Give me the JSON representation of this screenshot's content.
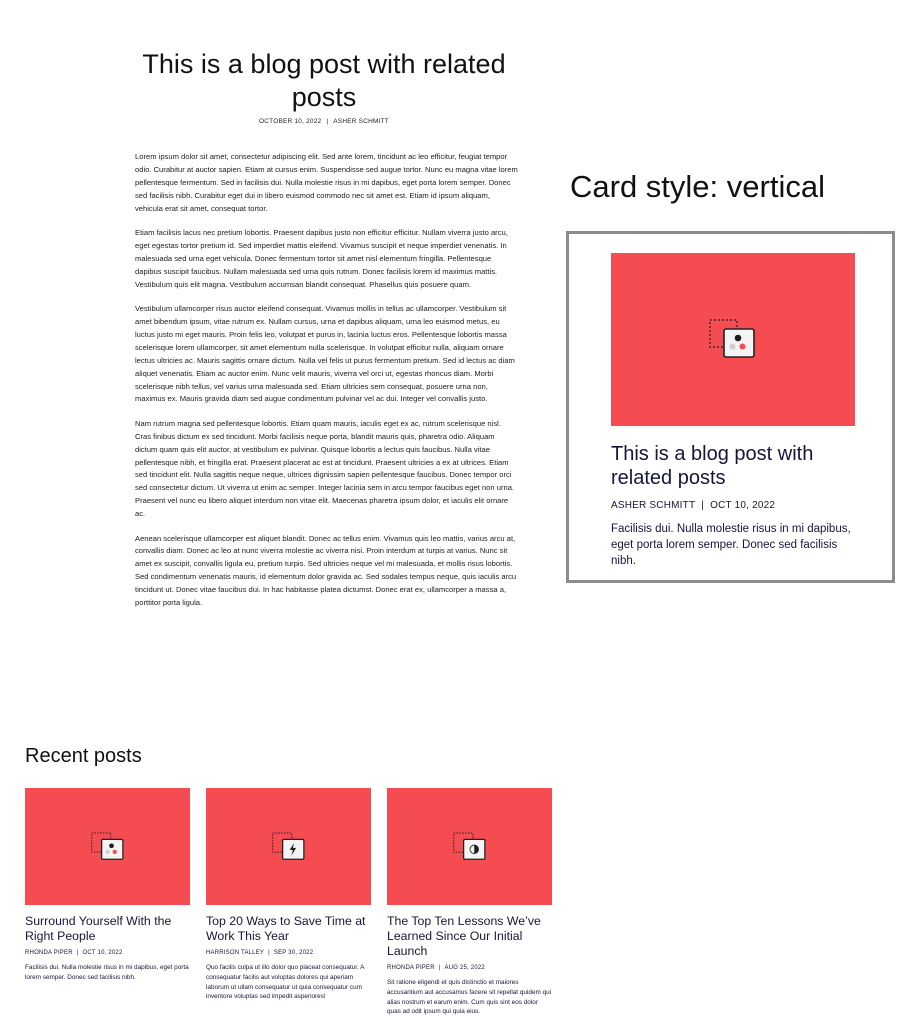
{
  "post": {
    "title": "This is a blog post with related posts",
    "date": "OCTOBER 10, 2022",
    "author": "ASHER SCHMITT",
    "paragraphs": [
      "Lorem ipsum dolor sit amet, consectetur adipiscing elit. Sed ante lorem, tincidunt ac leo efficitur, feugiat tempor odio. Curabitur at auctor sapien. Etiam at cursus enim. Suspendisse sed augue tortor. Nunc eu magna vitae lorem pellentesque fermentum. Sed in facilisis dui. Nulla molestie risus in mi dapibus, eget porta lorem semper. Donec sed facilisis nibh. Curabitur eget dui in libero euismod commodo nec sit amet est. Etiam id ipsum aliquam, vehicula erat sit amet, consequat tortor.",
      "Etiam facilisis lacus nec pretium lobortis. Praesent dapibus justo non efficitur efficitur. Nullam viverra justo arcu, eget egestas tortor pretium id. Sed imperdiet mattis eleifend. Vivamus suscipit et neque imperdiet venenatis. In malesuada sed urna eget vehicula. Donec fermentum tortor sit amet nisl elementum fringilla. Pellentesque dapibus suscipit faucibus. Nullam malesuada sed urna quis rutrum. Donec facilisis lorem id maximus mattis. Vestibulum quis elit magna. Vestibulum accumsan blandit consequat. Phasellus quis posuere quam.",
      "Vestibulum ullamcorper risus auctor eleifend consequat. Vivamus mollis in tellus ac ullamcorper. Vestibulum sit amet bibendum ipsum, vitae rutrum ex. Nullam cursus, urna et dapibus aliquam, urna leo euismod metus, eu luctus justo mi eget mauris. Proin felis leo, volutpat et purus in, lacinia luctus eros. Pellentesque lobortis massa scelerisque lorem ullamcorper, sit amet elementum nulla scelerisque. In volutpat efficitur nulla, aliquam ornare lectus ultricies ac. Mauris sagittis ornare dictum. Nulla vel felis ut purus fermentum pretium. Sed id lectus ac diam aliquet venenatis. Etiam ac auctor enim. Nunc velit mauris, viverra vel orci ut, egestas rhoncus diam. Morbi scelerisque nibh tellus, vel varius urna malesuada sed. Etiam ultricies sem consequat, posuere urna non, maximus ex. Mauris gravida diam sed augue condimentum pulvinar vel ac dui. Integer vel convallis justo.",
      "Nam rutrum magna sed pellentesque lobortis. Etiam quam mauris, iaculis eget ex ac, rutrum scelerisque nisl. Cras finibus dictum ex sed tincidunt. Morbi facilisis neque porta, blandit mauris quis, pharetra odio. Aliquam dictum quam quis elit auctor, at vestibulum ex pulvinar. Quisque lobortis a lectus quis faucibus. Nulla vitae pellentesque nibh, et fringilla erat. Praesent placerat ac est at tincidunt. Praesent ultricies a ex at ultrices. Etiam sed tincidunt elit. Nulla sagittis neque neque, ultrices dignissim sapien pellentesque faucibus. Donec tempor orci sed consectetur dictum. Ut viverra ut enim ac semper. Integer lacinia sem in arcu tempor faucibus eget non urna. Praesent vel nunc eu libero aliquet interdum non vitae elit. Maecenas pharetra ipsum dolor, et iaculis elit ornare ac.",
      "Aenean scelerisque ullamcorper est aliquet blandit. Donec ac tellus enim. Vivamus quis leo mattis, varius arcu at, convallis diam. Donec ac leo at nunc viverra molestie ac viverra nisi. Proin interdum at turpis at varius. Nunc sit amet ex suscipit, convallis ligula eu, pretium turpis. Sed ultricies neque vel mi malesuada, et mollis risus lobortis. Sed condimentum venenatis mauris, id elementum dolor gravida ac. Sed sodales tempus neque, quis iaculis arcu tincidunt ut. Donec vitae faucibus dui. In hac habitasse platea dictumst. Donec erat ex, ullamcorper a massa a, porttitor porta ligula."
    ]
  },
  "card_style_label": "Card style: vertical",
  "card": {
    "title": "This is a blog post with related posts",
    "author": "ASHER SCHMITT",
    "date": "OCT 10, 2022",
    "excerpt": "Facilisis dui. Nulla molestie risus in mi dapibus, eget porta lorem semper. Donec sed facilisis nibh.",
    "image_color": "#f54c52",
    "icon": "image-placeholder-dots-icon"
  },
  "recent": {
    "heading": "Recent posts",
    "posts": [
      {
        "title": "Surround Yourself With the Right People",
        "author": "RHONDA PIPER",
        "date": "OCT 10, 2022",
        "excerpt": "Facilisis dui. Nulla molestie risus in mi dapibus, eget porta lorem semper. Donec sed facilisis nibh.",
        "icon": "image-placeholder-dots-icon"
      },
      {
        "title": "Top 20 Ways to Save Time at Work This Year",
        "author": "HARRISON TALLEY",
        "date": "SEP 30, 2022",
        "excerpt": "Quo facilis culpa ut illo dolor quo placeat consequatur. A consequatur facilis aut voluptas dolores qui aperiam laborum ut ullam consequatur ut quia consequatur cum inventore voluptas sed impedit asperiores!",
        "icon": "image-placeholder-bolt-icon"
      },
      {
        "title": "The Top Ten Lessons We’ve Learned Since Our Initial Launch",
        "author": "RHONDA PIPER",
        "date": "AUG 25, 2022",
        "excerpt": "Sit ratione eligendi et quis distinctio et maiores accusantium aut accusamus facere sit repellat quidem qui alias nostrum et earum enim. Cum quis sint eos dolor quas ad odit ipsum qui quia eius.",
        "icon": "image-placeholder-halfcircle-icon"
      }
    ]
  },
  "colors": {
    "accent": "#f54c52",
    "text_dark": "#16163a",
    "frame_border": "#8c8c8c"
  }
}
